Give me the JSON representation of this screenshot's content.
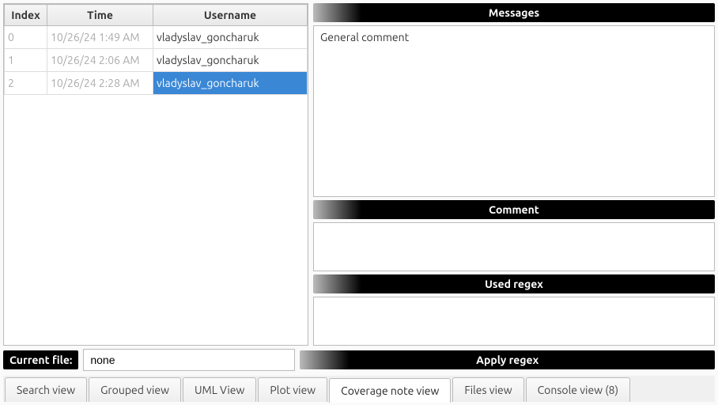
{
  "table": {
    "headers": {
      "index": "Index",
      "time": "Time",
      "username": "Username"
    },
    "rows": [
      {
        "index": "0",
        "time": "10/26/24 1:49 AM",
        "username": "vladyslav_goncharuk"
      },
      {
        "index": "1",
        "time": "10/26/24 2:06 AM",
        "username": "vladyslav_goncharuk"
      },
      {
        "index": "2",
        "time": "10/26/24 2:28 AM",
        "username": "vladyslav_goncharuk"
      }
    ],
    "selected_index": 2
  },
  "sections": {
    "messages": "Messages",
    "comment": "Comment",
    "used_regex": "Used regex",
    "apply_regex": "Apply regex"
  },
  "messages_content": "General comment",
  "comment_content": "",
  "used_regex_content": "",
  "footer": {
    "current_file_label": "Current file:",
    "current_file_value": "none"
  },
  "tabs": [
    {
      "label": "Search view"
    },
    {
      "label": "Grouped view"
    },
    {
      "label": "UML View"
    },
    {
      "label": "Plot view"
    },
    {
      "label": "Coverage note view",
      "active": true
    },
    {
      "label": "Files view"
    },
    {
      "label": "Console view (8)"
    }
  ]
}
